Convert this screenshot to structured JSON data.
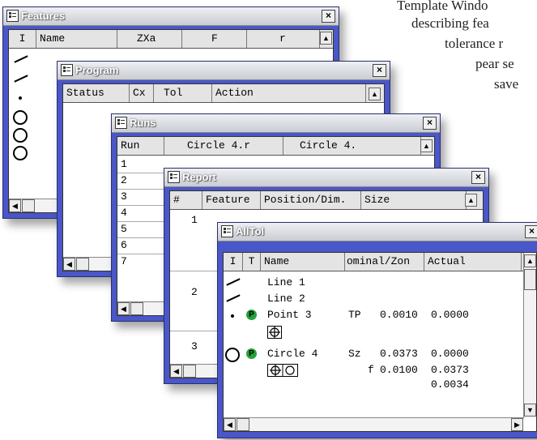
{
  "background_text": [
    "Template Windo",
    "describing fea",
    "tolerance r",
    "pear se",
    "save"
  ],
  "features": {
    "title": "Features",
    "close": "×",
    "columns": [
      "I",
      "Name",
      "ZXa",
      "F",
      "r"
    ],
    "icons": [
      "line-icon",
      "line-icon",
      "point-icon",
      "circle-icon",
      "circle-icon",
      "circle-icon"
    ]
  },
  "program": {
    "title": "Program",
    "close": "×",
    "columns": [
      "Status",
      "Cx",
      "Tol",
      "Action"
    ]
  },
  "runs": {
    "title": "Runs",
    "close": "×",
    "columns": [
      "Run",
      "Circle 4.r",
      "Circle 4."
    ],
    "rows": [
      "1",
      "2",
      "3",
      "4",
      "5",
      "6",
      "7"
    ]
  },
  "report": {
    "title": "Report",
    "close": "×",
    "columns": [
      "#",
      "Feature",
      "Position/Dim.",
      "Size"
    ],
    "rows": [
      "1",
      "2",
      "3"
    ]
  },
  "alltol": {
    "title": "AllTol",
    "close": "×",
    "columns": [
      "I",
      "T",
      "Name",
      "ominal/Zon",
      "Actual"
    ],
    "rows": [
      {
        "name": "Line 1",
        "icon": "line-icon"
      },
      {
        "name": "Line 2",
        "icon": "line-icon"
      },
      {
        "name": "Point 3",
        "icon": "point-icon",
        "badge": "P",
        "tol": "TP",
        "nominal": "0.0010",
        "actual": "0.0000"
      },
      {
        "name": "Circle 4",
        "icon": "circle-icon",
        "badge": "P",
        "tol": "Sz",
        "nominal": "0.0373",
        "actual": "0.0000"
      },
      {
        "tol": "f",
        "nominal": "0.0100",
        "actual": "0.0373"
      },
      {
        "actual": "0.0034"
      }
    ]
  },
  "colors": {
    "frame": "#4a57c8",
    "badge": "#23a23c"
  }
}
